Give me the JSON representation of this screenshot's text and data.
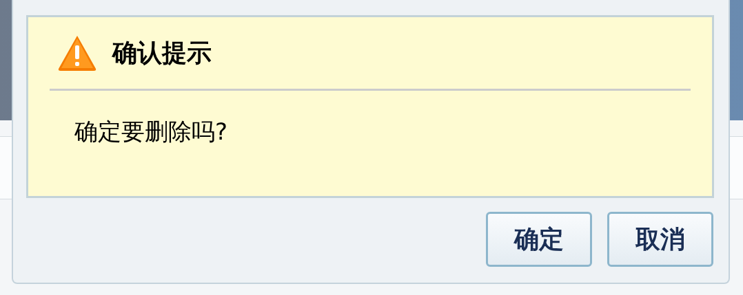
{
  "dialog": {
    "title": "确认提示",
    "message": "确定要删除吗?",
    "buttons": [
      {
        "label": "确定"
      },
      {
        "label": "取消"
      }
    ]
  }
}
